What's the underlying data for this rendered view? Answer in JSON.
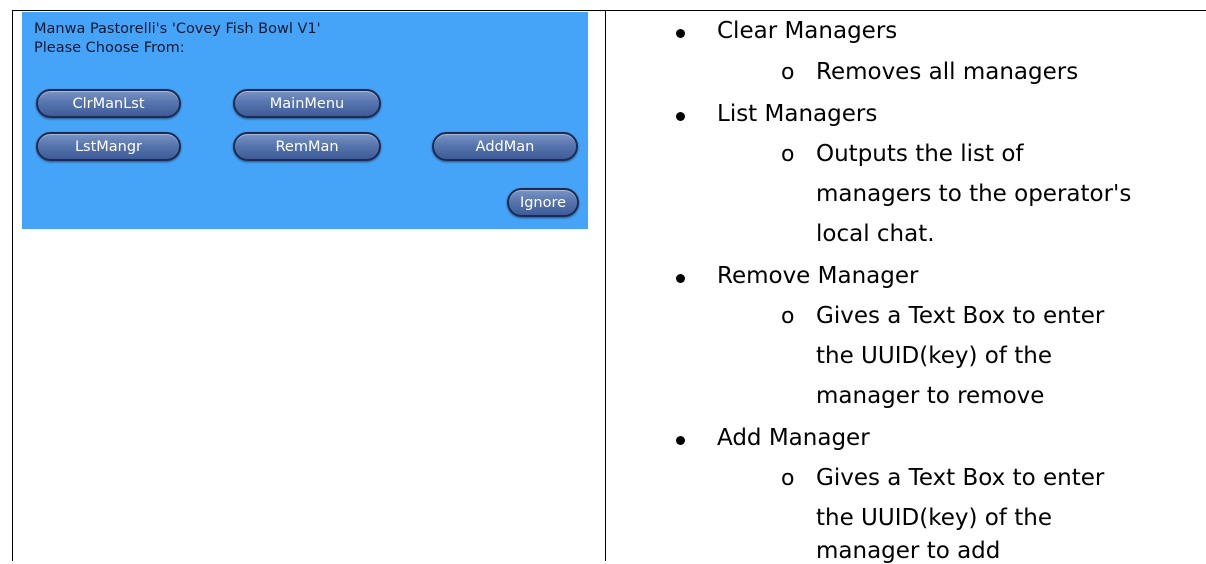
{
  "dialog": {
    "title_line": "Manwa Pastorelli's 'Covey Fish Bowl V1'",
    "prompt_line": "Please Choose From:",
    "buttons": {
      "clr_man_lst": "ClrManLst",
      "main_menu": "MainMenu",
      "lst_mangr": "LstMangr",
      "rem_man": "RemMan",
      "add_man": "AddMan",
      "ignore": "Ignore"
    },
    "background_color": "#46a4f8"
  },
  "list": {
    "sub_bullet_glyph": "o",
    "items": [
      {
        "label": "Clear Managers",
        "desc_lines": [
          "Removes all managers"
        ]
      },
      {
        "label": "List Managers",
        "desc_lines": [
          "Outputs the list of",
          "managers to the operator's",
          "local chat."
        ]
      },
      {
        "label": "Remove Manager",
        "desc_lines": [
          "Gives a Text Box to enter",
          "the UUID(key) of the",
          "manager to remove"
        ]
      },
      {
        "label": "Add Manager",
        "desc_lines": [
          "Gives a Text Box to enter",
          "the UUID(key) of the",
          "manager to add"
        ]
      }
    ]
  }
}
